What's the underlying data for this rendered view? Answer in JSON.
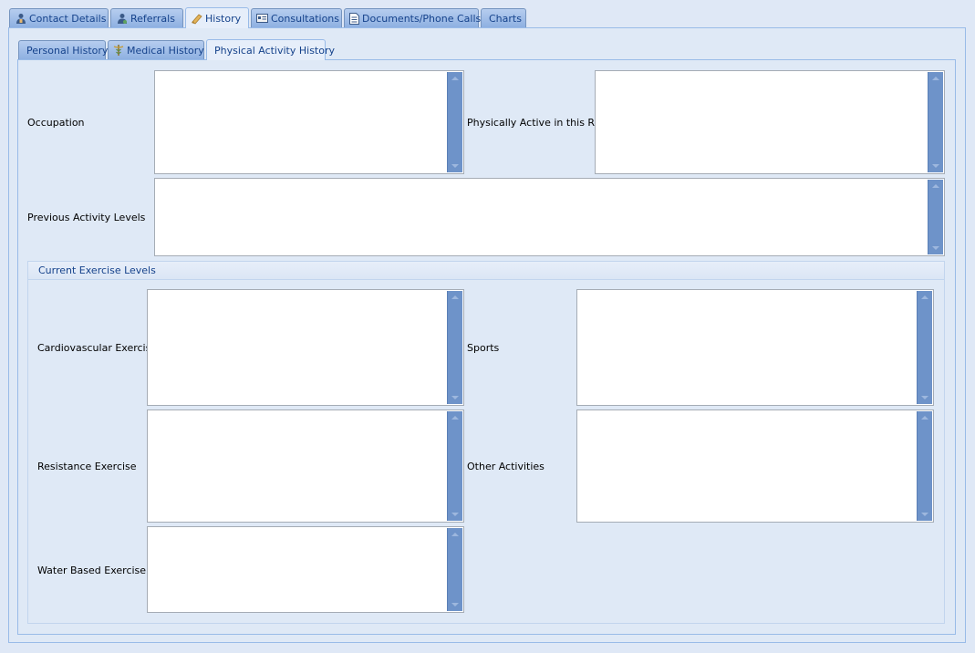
{
  "main_tabs": [
    {
      "label": "Contact Details",
      "icon": "contact-icon"
    },
    {
      "label": "Referrals",
      "icon": "referral-person-icon"
    },
    {
      "label": "History",
      "icon": "history-scroll-icon",
      "active": true
    },
    {
      "label": "Consultations",
      "icon": "consultation-card-icon"
    },
    {
      "label": "Documents/Phone Calls",
      "icon": "document-icon"
    },
    {
      "label": "Charts",
      "icon": ""
    }
  ],
  "sub_tabs": [
    {
      "label": "Personal History",
      "icon": ""
    },
    {
      "label": "Medical History",
      "icon": "caduceus-icon"
    },
    {
      "label": "Physical Activity History",
      "icon": "",
      "active": true
    }
  ],
  "fields": {
    "occupation": {
      "label": "Occupation",
      "value": ""
    },
    "physically_active_role": {
      "label": "Physically Active in this Role",
      "value": ""
    },
    "previous_activity_levels": {
      "label": "Previous Activity Levels",
      "value": ""
    }
  },
  "current_exercise": {
    "title": "Current Exercise Levels",
    "cardiovascular": {
      "label": "Cardiovascular Exercise",
      "value": ""
    },
    "sports": {
      "label": "Sports",
      "value": ""
    },
    "resistance": {
      "label": "Resistance Exercise",
      "value": ""
    },
    "other_activities": {
      "label": "Other Activities",
      "value": ""
    },
    "water_based": {
      "label": "Water Based Exercise",
      "value": ""
    }
  },
  "colors": {
    "accent": "#15428b",
    "panel_bg": "#dfe9f6",
    "scrollbar": "#6e93c9"
  }
}
